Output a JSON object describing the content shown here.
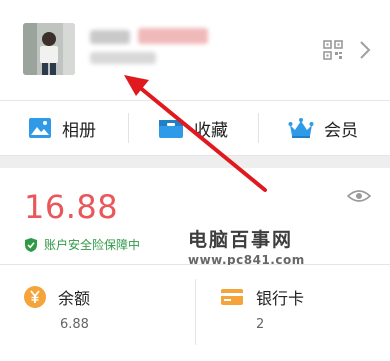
{
  "quick_actions": [
    {
      "label": "相册",
      "icon": "photo-album-icon",
      "color": "#2f9be8"
    },
    {
      "label": "收藏",
      "icon": "favorites-box-icon",
      "color": "#2f9be8"
    },
    {
      "label": "会员",
      "icon": "crown-icon",
      "color": "#2f9be8"
    }
  ],
  "balance": {
    "amount": "16.88",
    "safety_text": "账户安全险保障中",
    "amount_color": "#e8585b",
    "safety_color": "#2f9a46"
  },
  "accounts": [
    {
      "title": "余额",
      "value": "6.88",
      "icon": "yen-coin-icon",
      "color": "#f4a43a"
    },
    {
      "title": "银行卡",
      "value": "2",
      "icon": "bank-card-icon",
      "color": "#f4a43a"
    }
  ],
  "watermark": {
    "main": "电脑百事网",
    "url": "www.pc841.com"
  }
}
